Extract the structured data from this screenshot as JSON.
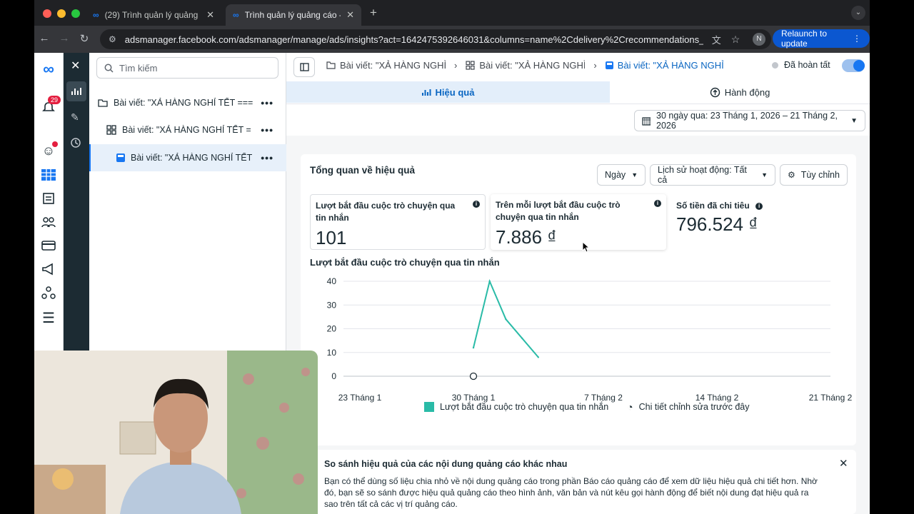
{
  "browser": {
    "tabs": [
      {
        "title": "(29) Trình quản lý quảng cáo",
        "active": false
      },
      {
        "title": "Trình quản lý quảng cáo - Qu",
        "active": true
      }
    ],
    "url": "adsmanager.facebook.com/adsmanager/manage/ads/insights?act=1642475392646031&columns=name%2Cdelivery%2Crecommendations_guida...",
    "profile_initial": "N",
    "relaunch_label": "Relaunch to update"
  },
  "rail": {
    "notification_count": "29"
  },
  "tree": {
    "search_placeholder": "Tìm kiếm",
    "items": [
      {
        "label": "Bài viết: \"XẢ HÀNG NGHỈ TẾT === ...",
        "level": 0,
        "icon": "folder-icon"
      },
      {
        "label": "Bài viết: \"XẢ HÀNG NGHỈ TẾT =...",
        "level": 1,
        "icon": "grid-icon"
      },
      {
        "label": "Bài viết: \"XẢ HÀNG NGHỈ TẾT ...",
        "level": 2,
        "icon": "ad-icon",
        "selected": true
      }
    ]
  },
  "header": {
    "crumbs": [
      "Bài viết: \"XẢ HÀNG NGHỈ T",
      "Bài viết: \"XẢ HÀNG NGHỈ T",
      "Bài viết: \"XẢ HÀNG NGHỈ T"
    ],
    "status": "Đã hoàn tất"
  },
  "tabs": {
    "performance": "Hiệu quả",
    "actions": "Hành động"
  },
  "date_range": "30 ngày qua: 23 Tháng 1, 2026 – 21 Tháng 2, 2026",
  "overview": {
    "title": "Tổng quan về hiệu quả",
    "day_button": "Ngày",
    "activity_button": "Lịch sử hoạt động: Tất cả",
    "customize_button": "Tùy chỉnh",
    "metrics": [
      {
        "label": "Lượt bắt đầu cuộc trò chuyện qua tin nhắn",
        "value": "101"
      },
      {
        "label": "Trên mỗi lượt bắt đầu cuộc trò chuyện qua tin nhắn",
        "value": "7.886 ₫"
      },
      {
        "label": "Số tiền đã chi tiêu",
        "value": "796.524 ₫"
      }
    ]
  },
  "chart_data": {
    "type": "line",
    "title": "Lượt bắt đầu cuộc trò chuyện qua tin nhắn",
    "ylim": [
      0,
      40
    ],
    "yticks": [
      "40",
      "30",
      "20",
      "10",
      "0"
    ],
    "xticks": [
      "23 Tháng 1",
      "30 Tháng 1",
      "7 Tháng 2",
      "14 Tháng 2",
      "21 Tháng 2"
    ],
    "series": [
      {
        "name": "Lượt bắt đầu cuộc trò chuyện qua tin nhắn",
        "color": "#2abba7",
        "x": [
          "30 Tháng 1",
          "31 Tháng 1",
          "1 Tháng 2",
          "2 Tháng 2",
          "3 Tháng 2"
        ],
        "values": [
          12,
          40,
          24,
          16,
          8
        ]
      }
    ],
    "legend": [
      "Lượt bắt đầu cuộc trò chuyện qua tin nhắn",
      "Chi tiết chỉnh sửa trước đây"
    ],
    "grid": true
  },
  "notice": {
    "title": "So sánh hiệu quả của các nội dung quảng cáo khác nhau",
    "body": "Bạn có thể dùng số liệu chia nhỏ về nội dung quảng cáo trong phần Báo cáo quảng cáo để xem dữ liệu hiệu quả chi tiết hơn. Nhờ đó, bạn sẽ so sánh được hiệu quả quảng cáo theo hình ảnh, văn bản và nút kêu gọi hành động để biết nội dung đạt hiệu quả ra sao trên tất cả các vị trí quảng cáo."
  },
  "colors": {
    "accent": "#1877f2",
    "series": "#2abba7",
    "rail_dark": "#1c2b33"
  }
}
